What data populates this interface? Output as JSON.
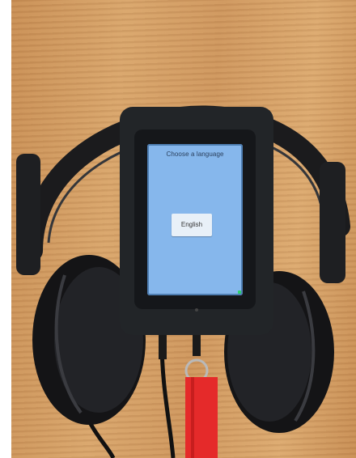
{
  "screen": {
    "title": "Choose a language",
    "language_button": "English"
  },
  "colors": {
    "screen_background": "#86b7ec",
    "wood": "#d9a66c",
    "device_body": "#222528",
    "strap": "#e52a2a"
  }
}
